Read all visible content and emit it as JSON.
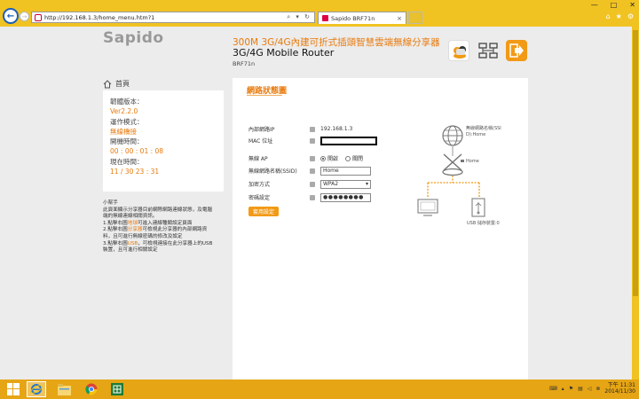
{
  "browser": {
    "url": "http://192.168.1.3/home_menu.htm?1",
    "tab_title": "Sapido BRF71n",
    "tab_close": "×",
    "addr_tools": "⌕ ▾ ↻"
  },
  "header": {
    "logo": "Sapido",
    "title_cn": "300M 3G/4G內建可折式插頭智慧雲端無線分享器",
    "title_en": "3G/4G Mobile Router",
    "model": "BRF71n"
  },
  "sidebar": {
    "home_label": "首頁",
    "firmware_label": "韌體版本：",
    "firmware_value": "Ver2.2.0",
    "mode_label": "運作模式：",
    "mode_value": "無線橋接",
    "uptime_label": "開機時間：",
    "uptime_value": "00 : 00 : 01 : 08",
    "time_label": "現在時間：",
    "time_value": "11 / 30  23 : 31",
    "tips": {
      "title": "小幫手",
      "line1": "此頁面顯示分享器目前網際網路連線狀態，及電腦",
      "line2": "端的無線連線相關資訊。",
      "line3_a": "1.點擊右圖",
      "line3_hl": "地球",
      "line3_b": "可進入連線種類設定頁面",
      "line4_a": "2.點擊右圖",
      "line4_hl": "分享器",
      "line4_b": "可檢視此分享器的內部網路資",
      "line5": "料，且可進行無線密碼的修改及設定",
      "line6_a": "3.點擊右圖",
      "line6_hl": "USB",
      "line6_b": "，可檢視連接在此分享器上的USB",
      "line7": "裝置，且可進行相關設定"
    }
  },
  "panel": {
    "title": "網路狀態圖",
    "fields": {
      "lan_ip_label": "內部網路IP",
      "lan_ip_value": "192.168.1.3",
      "mac_label": "MAC 位址",
      "wireless_ap_label": "無線 AP",
      "ap_on": "開啟",
      "ap_off": "關閉",
      "ssid_label": "無線網路名稱(SSID)",
      "ssid_value": "Home",
      "encryption_label": "加密方式",
      "encryption_value": "WPA2",
      "password_label": "密碼設定",
      "password_value": "●●●●●●●●"
    },
    "apply_button": "套用設定",
    "diagram": {
      "wan_label_1": "無線網路名稱(SSI",
      "wan_label_2": "D):Home",
      "router_label": "Home",
      "usb_label": "USB 儲存裝置:0"
    }
  },
  "taskbar": {
    "clock_time": "下午 11:31",
    "clock_date": "2014/11/30"
  },
  "colors": {
    "accent": "#e87a0c",
    "chrome": "#f0c323",
    "taskbar": "#e6a515"
  }
}
